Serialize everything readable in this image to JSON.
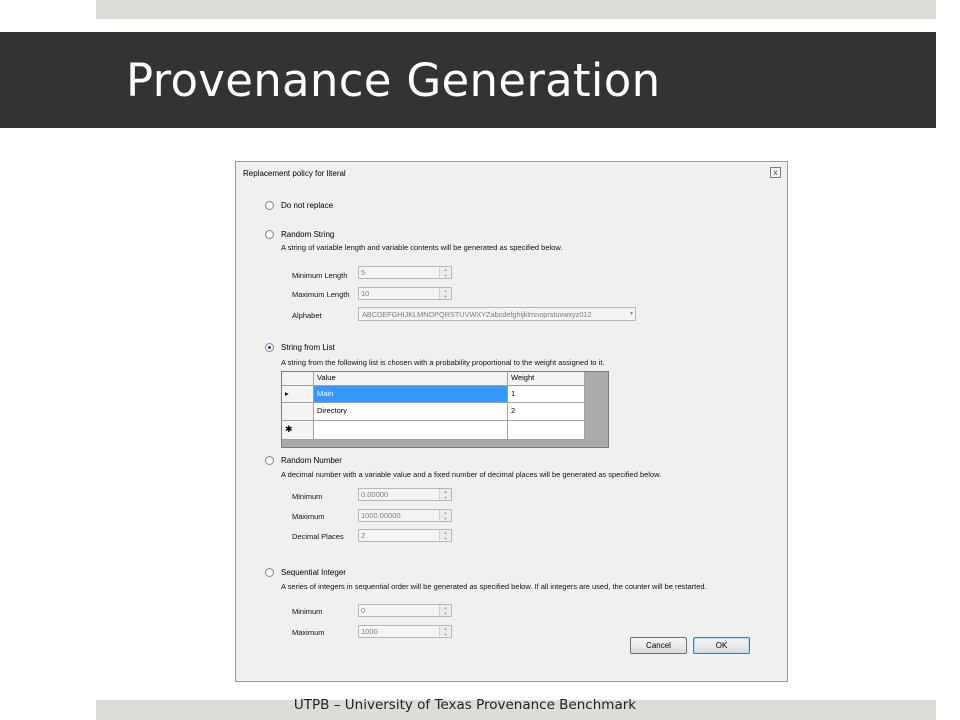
{
  "slide": {
    "title": "Provenance Generation",
    "footer": "UTPB – University of Texas Provenance Benchmark"
  },
  "dialog": {
    "title": "Replacement policy for literal",
    "close_label": "x",
    "options": {
      "do_not_replace": {
        "label": "Do not replace",
        "checked": false
      },
      "random_string": {
        "label": "Random String",
        "checked": false,
        "description": "A string of variable length and variable contents will be generated as specified below.",
        "min_length_label": "Minimum Length",
        "min_length_value": "5",
        "max_length_label": "Maximum Length",
        "max_length_value": "10",
        "alphabet_label": "Alphabet",
        "alphabet_value": "ABCDEFGHIJKLMNOPQRSTUVWXYZabcdefghijklmnoprstuvwxyz012"
      },
      "string_from_list": {
        "label": "String from List",
        "checked": true,
        "description": "A string from the following list is chosen with a probability proportional to the weight assigned to it.",
        "columns": [
          "Value",
          "Weight"
        ],
        "rows": [
          {
            "value": "Main",
            "weight": "1",
            "selected": true,
            "row_marker": "▸"
          },
          {
            "value": "Directory",
            "weight": "2",
            "selected": false,
            "row_marker": ""
          }
        ],
        "new_row_marker": "✱"
      },
      "random_number": {
        "label": "Random Number",
        "checked": false,
        "description": "A decimal number with a variable value and a fixed number of decimal places will be generated as specified below.",
        "minimum_label": "Minimum",
        "minimum_value": "0.00000",
        "maximum_label": "Maximum",
        "maximum_value": "1000.00000",
        "decimal_places_label": "Decimal Places",
        "decimal_places_value": "2"
      },
      "sequential_integer": {
        "label": "Sequential Integer",
        "checked": false,
        "description": "A series of integers in sequential order will be generated as specified below.  If all integers are used, the counter will be restarted.",
        "minimum_label": "Minimum",
        "minimum_value": "0",
        "maximum_label": "Maximum",
        "maximum_value": "1000"
      }
    },
    "buttons": {
      "cancel": "Cancel",
      "ok": "OK"
    },
    "spin_up_glyph": "▲",
    "spin_down_glyph": "▼",
    "dropdown_glyph": "▾"
  }
}
